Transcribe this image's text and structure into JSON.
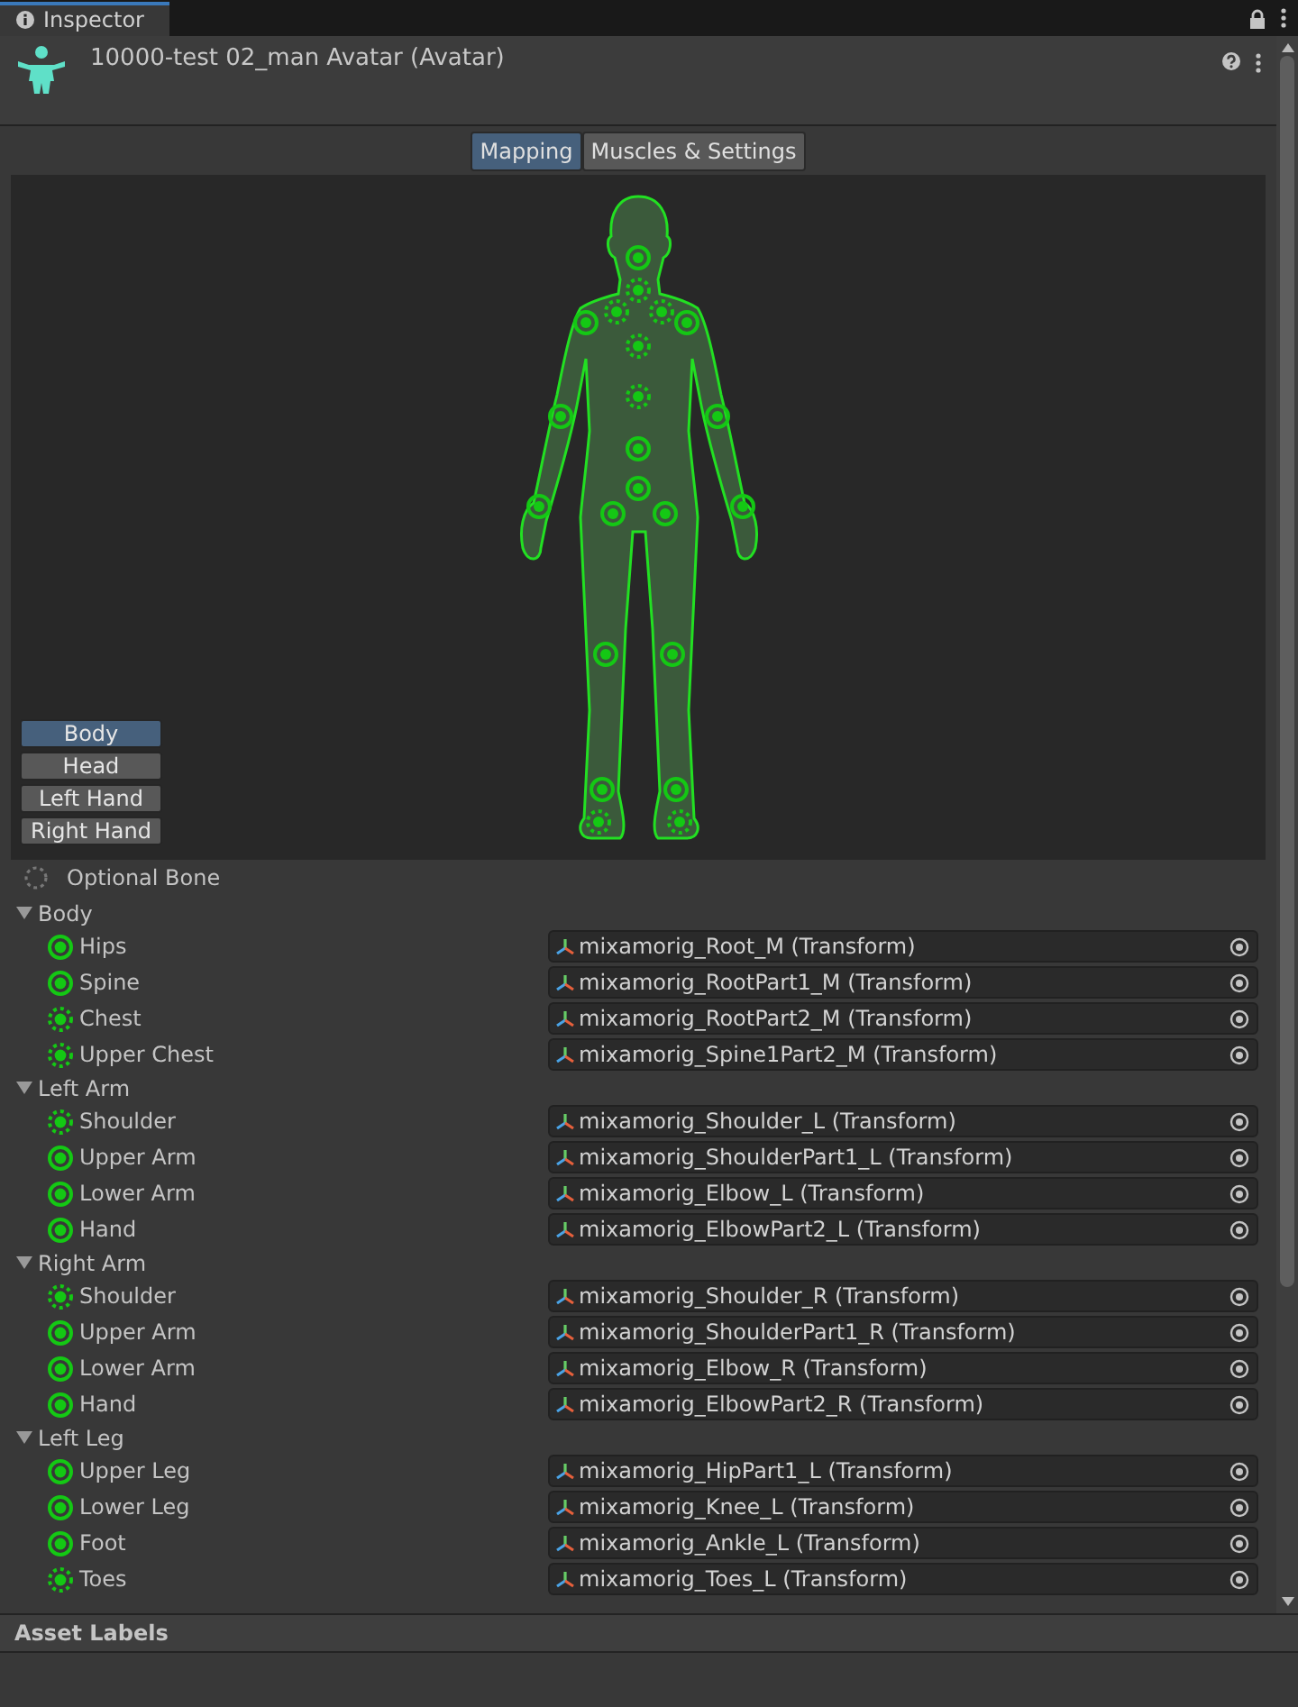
{
  "window": {
    "title": "Inspector"
  },
  "asset": {
    "title": "10000-test 02_man Avatar (Avatar)"
  },
  "tabs": [
    {
      "label": "Mapping",
      "selected": true
    },
    {
      "label": "Muscles & Settings",
      "selected": false
    }
  ],
  "views": [
    {
      "label": "Body",
      "selected": true
    },
    {
      "label": "Head",
      "selected": false
    },
    {
      "label": "Left Hand",
      "selected": false
    },
    {
      "label": "Right Hand",
      "selected": false
    }
  ],
  "legend": {
    "label": "Optional Bone"
  },
  "groups": [
    {
      "name": "Body",
      "expanded": true,
      "bones": [
        {
          "name": "Hips",
          "optional": false,
          "value": "mixamorig_Root_M (Transform)"
        },
        {
          "name": "Spine",
          "optional": false,
          "value": "mixamorig_RootPart1_M (Transform)"
        },
        {
          "name": "Chest",
          "optional": true,
          "value": "mixamorig_RootPart2_M (Transform)"
        },
        {
          "name": "Upper Chest",
          "optional": true,
          "value": "mixamorig_Spine1Part2_M (Transform)"
        }
      ]
    },
    {
      "name": "Left Arm",
      "expanded": true,
      "bones": [
        {
          "name": "Shoulder",
          "optional": true,
          "value": "mixamorig_Shoulder_L (Transform)"
        },
        {
          "name": "Upper Arm",
          "optional": false,
          "value": "mixamorig_ShoulderPart1_L (Transform)"
        },
        {
          "name": "Lower Arm",
          "optional": false,
          "value": "mixamorig_Elbow_L (Transform)"
        },
        {
          "name": "Hand",
          "optional": false,
          "value": "mixamorig_ElbowPart2_L (Transform)"
        }
      ]
    },
    {
      "name": "Right Arm",
      "expanded": true,
      "bones": [
        {
          "name": "Shoulder",
          "optional": true,
          "value": "mixamorig_Shoulder_R (Transform)"
        },
        {
          "name": "Upper Arm",
          "optional": false,
          "value": "mixamorig_ShoulderPart1_R (Transform)"
        },
        {
          "name": "Lower Arm",
          "optional": false,
          "value": "mixamorig_Elbow_R (Transform)"
        },
        {
          "name": "Hand",
          "optional": false,
          "value": "mixamorig_ElbowPart2_R (Transform)"
        }
      ]
    },
    {
      "name": "Left Leg",
      "expanded": true,
      "bones": [
        {
          "name": "Upper Leg",
          "optional": false,
          "value": "mixamorig_HipPart1_L (Transform)"
        },
        {
          "name": "Lower Leg",
          "optional": false,
          "value": "mixamorig_Knee_L (Transform)"
        },
        {
          "name": "Foot",
          "optional": false,
          "value": "mixamorig_Ankle_L (Transform)"
        },
        {
          "name": "Toes",
          "optional": true,
          "value": "mixamorig_Toes_L (Transform)"
        }
      ]
    }
  ],
  "footer": {
    "title": "Asset Labels"
  }
}
